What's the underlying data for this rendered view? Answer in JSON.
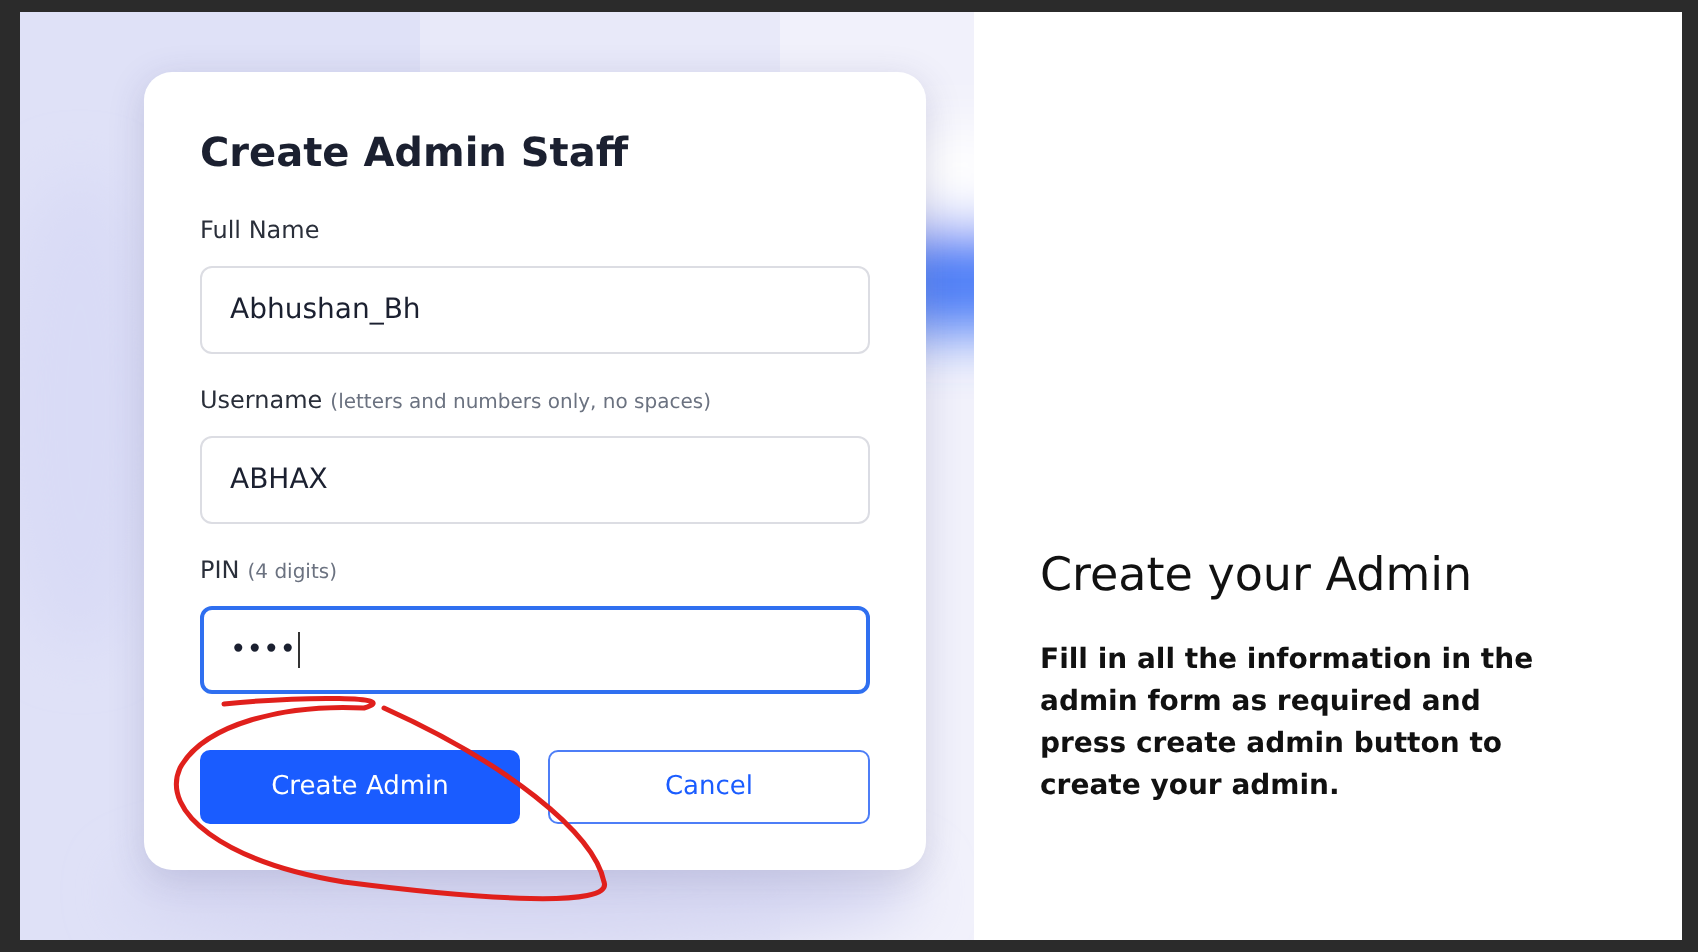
{
  "form": {
    "title": "Create Admin Staff",
    "fields": [
      {
        "label": "Full Name",
        "value": "Abhushan_Bh",
        "focused": false
      },
      {
        "label": "Username",
        "hint": "(letters and numbers only, no spaces)",
        "value": "ABHAX",
        "focused": false
      },
      {
        "label": "PIN",
        "hint": "(4 digits)",
        "value": "••••",
        "focused": true
      }
    ],
    "buttons": [
      {
        "label": "Create Admin",
        "kind": "primary"
      },
      {
        "label": "Cancel",
        "kind": "secondary"
      }
    ]
  },
  "info": {
    "heading": "Create your Admin",
    "body": "Fill in all the information in the admin form as required and press create admin button to create your admin."
  }
}
